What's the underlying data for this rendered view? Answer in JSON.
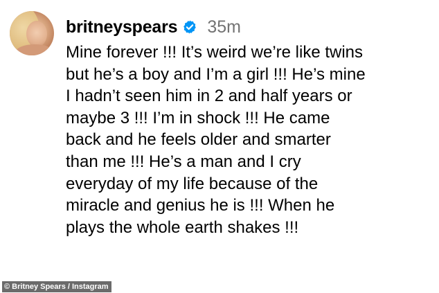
{
  "post": {
    "username": "britneyspears",
    "timestamp": "35m",
    "avatar_icon": "profile-photo",
    "verified_icon": "verified-badge-icon",
    "verified_color": "#0095f6",
    "caption_lines": [
      "Mine forever !!! It’s weird we’re like twins",
      "but he’s a boy and I’m a girl !!! He’s mine",
      "I hadn’t seen him in 2 and half years or",
      "maybe 3 !!! I’m in shock !!! He came",
      "back and he feels older and smarter",
      "than me !!! He’s a man and I cry",
      "everyday of my life because of the",
      "miracle and genius he is !!! When he",
      "plays the whole earth shakes !!!"
    ]
  },
  "credit": {
    "text": "© Britney Spears / Instagram"
  }
}
